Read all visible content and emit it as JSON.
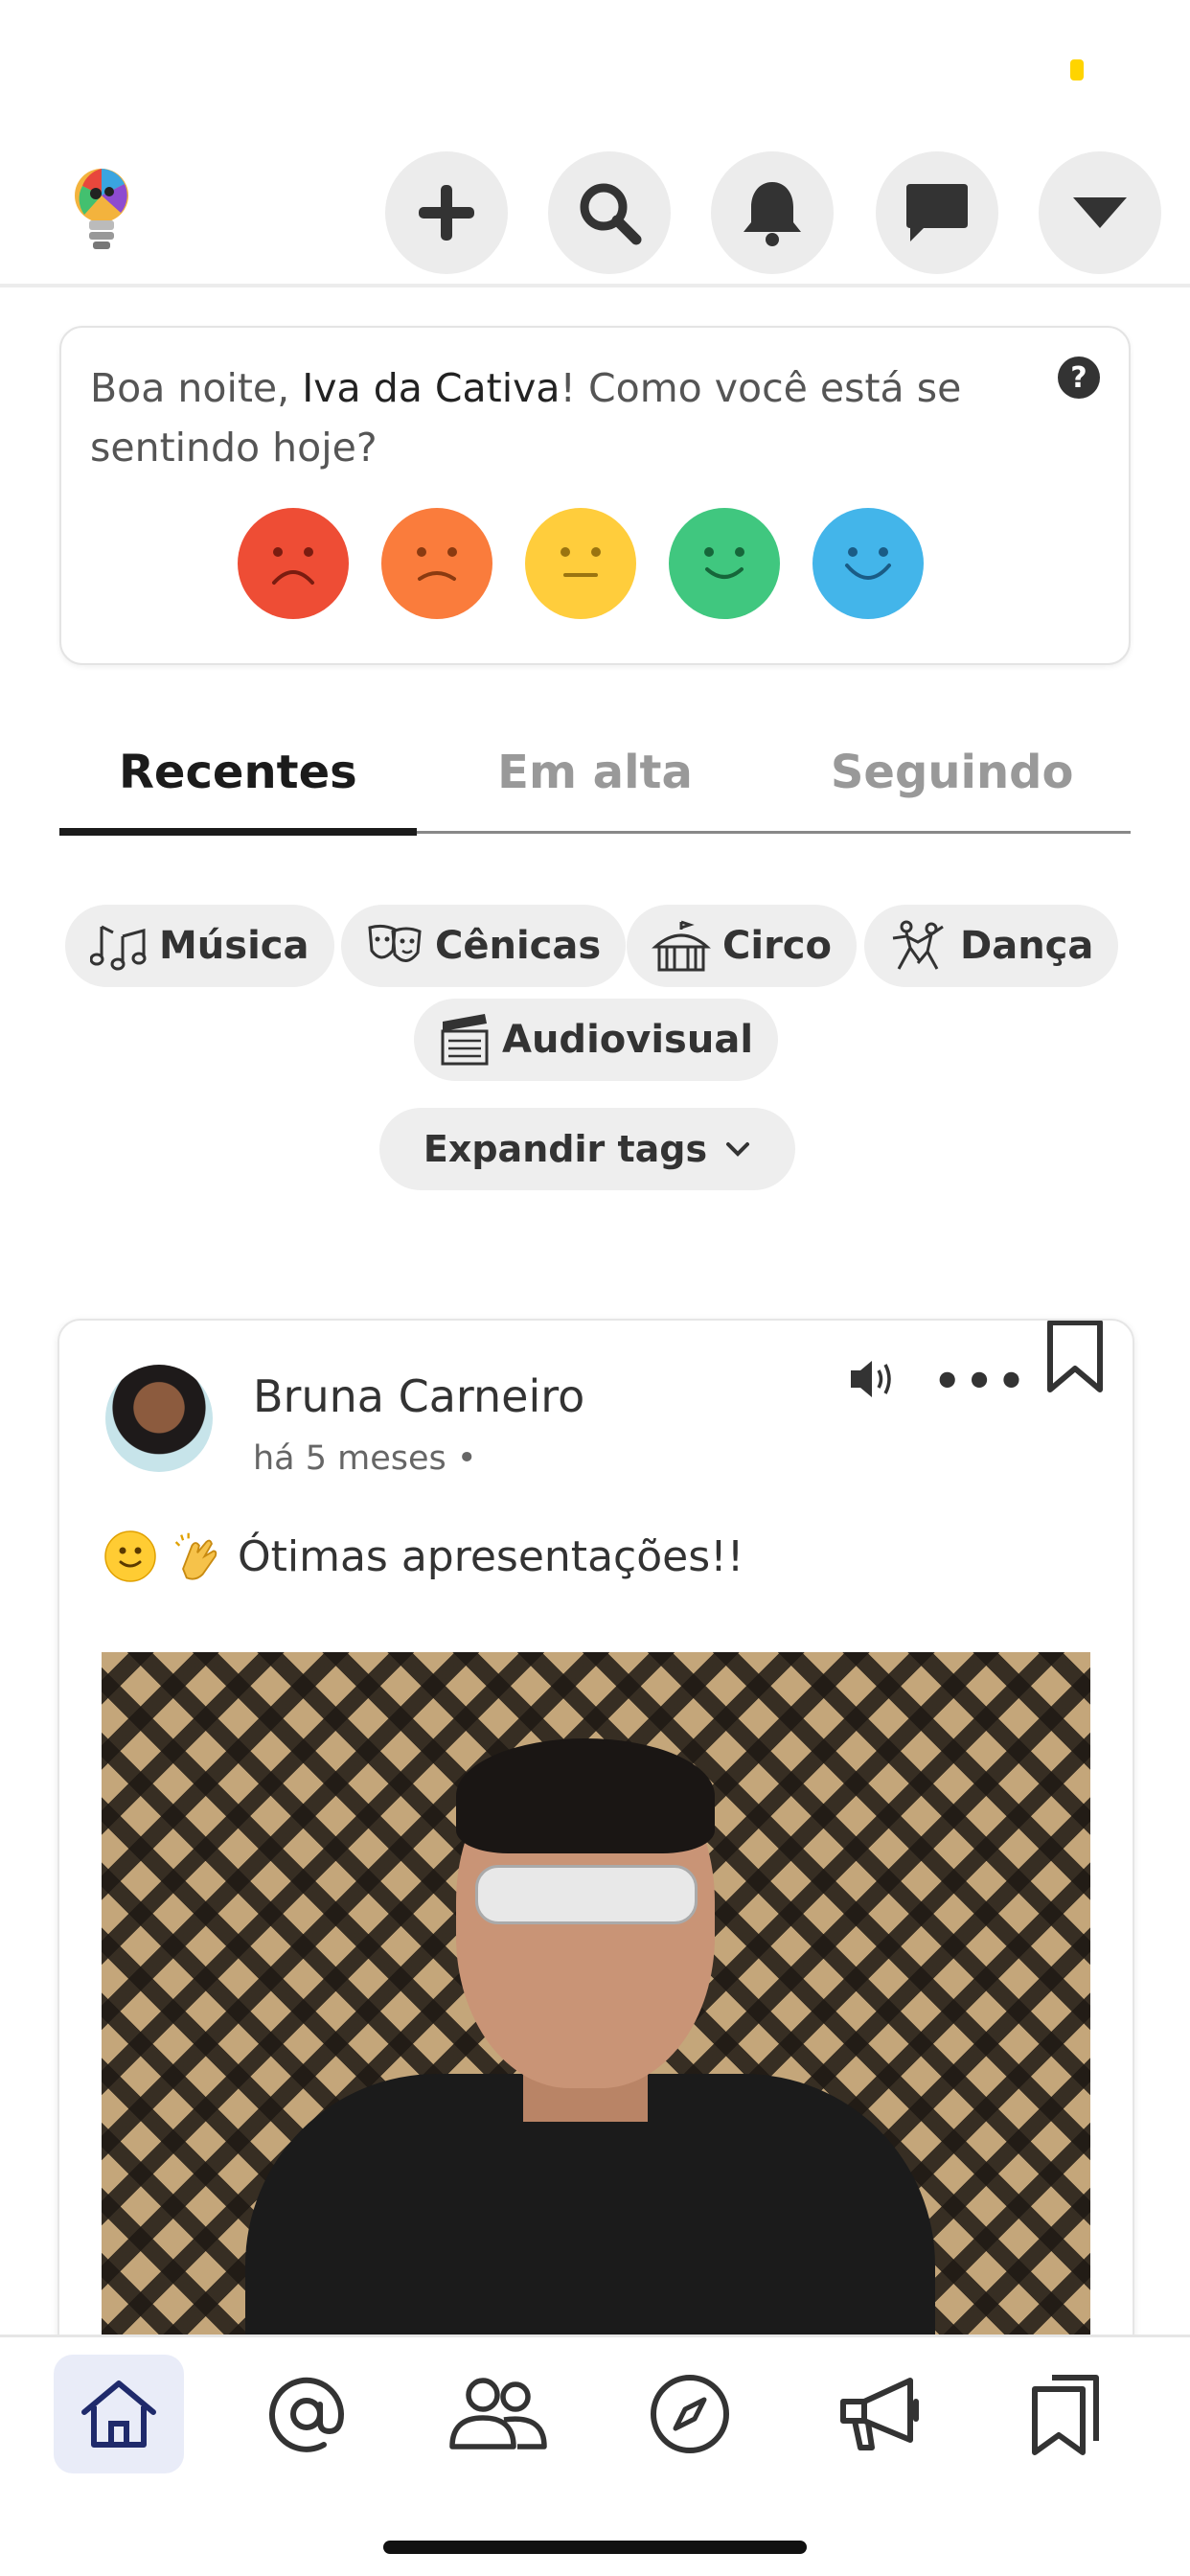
{
  "header": {
    "logo_icon": "lightbulb-logo-icon",
    "buttons": [
      {
        "name": "add-button",
        "icon": "plus-icon"
      },
      {
        "name": "search-button",
        "icon": "search-icon"
      },
      {
        "name": "notifications-button",
        "icon": "bell-icon"
      },
      {
        "name": "messages-button",
        "icon": "chat-icon"
      },
      {
        "name": "menu-dropdown-button",
        "icon": "caret-down-icon"
      }
    ]
  },
  "mood": {
    "greeting_prefix": "Boa noite, ",
    "user_name": "Iva da Cativa",
    "greeting_suffix": "! Como você está se sentindo hoje?",
    "help": "?",
    "faces": [
      {
        "name": "very-sad",
        "color": "#ee4d35"
      },
      {
        "name": "sad",
        "color": "#fa7c3c"
      },
      {
        "name": "neutral",
        "color": "#ffcd3c"
      },
      {
        "name": "happy",
        "color": "#40c77f"
      },
      {
        "name": "very-happy",
        "color": "#43b5ea"
      }
    ]
  },
  "tabs": [
    {
      "label": "Recentes",
      "active": true
    },
    {
      "label": "Em alta",
      "active": false
    },
    {
      "label": "Seguindo",
      "active": false
    }
  ],
  "tags": {
    "musica": "Música",
    "cenicas": "Cênicas",
    "circo": "Circo",
    "danca": "Dança",
    "audiovisual": "Audiovisual",
    "expand": "Expandir tags"
  },
  "post": {
    "author": "Bruna Carneiro",
    "time": "há 5 meses •",
    "text": "Ótimas apresentações!!",
    "more": "•••"
  },
  "nav": [
    {
      "name": "home",
      "active": true
    },
    {
      "name": "mentions",
      "active": false
    },
    {
      "name": "groups",
      "active": false
    },
    {
      "name": "explore",
      "active": false
    },
    {
      "name": "announcements",
      "active": false
    },
    {
      "name": "saved",
      "active": false
    }
  ],
  "colors": {
    "accent_nav": "#1f2a6b",
    "nav_active_bg": "#e9ecf8",
    "status_indicator": "#ffd400"
  }
}
